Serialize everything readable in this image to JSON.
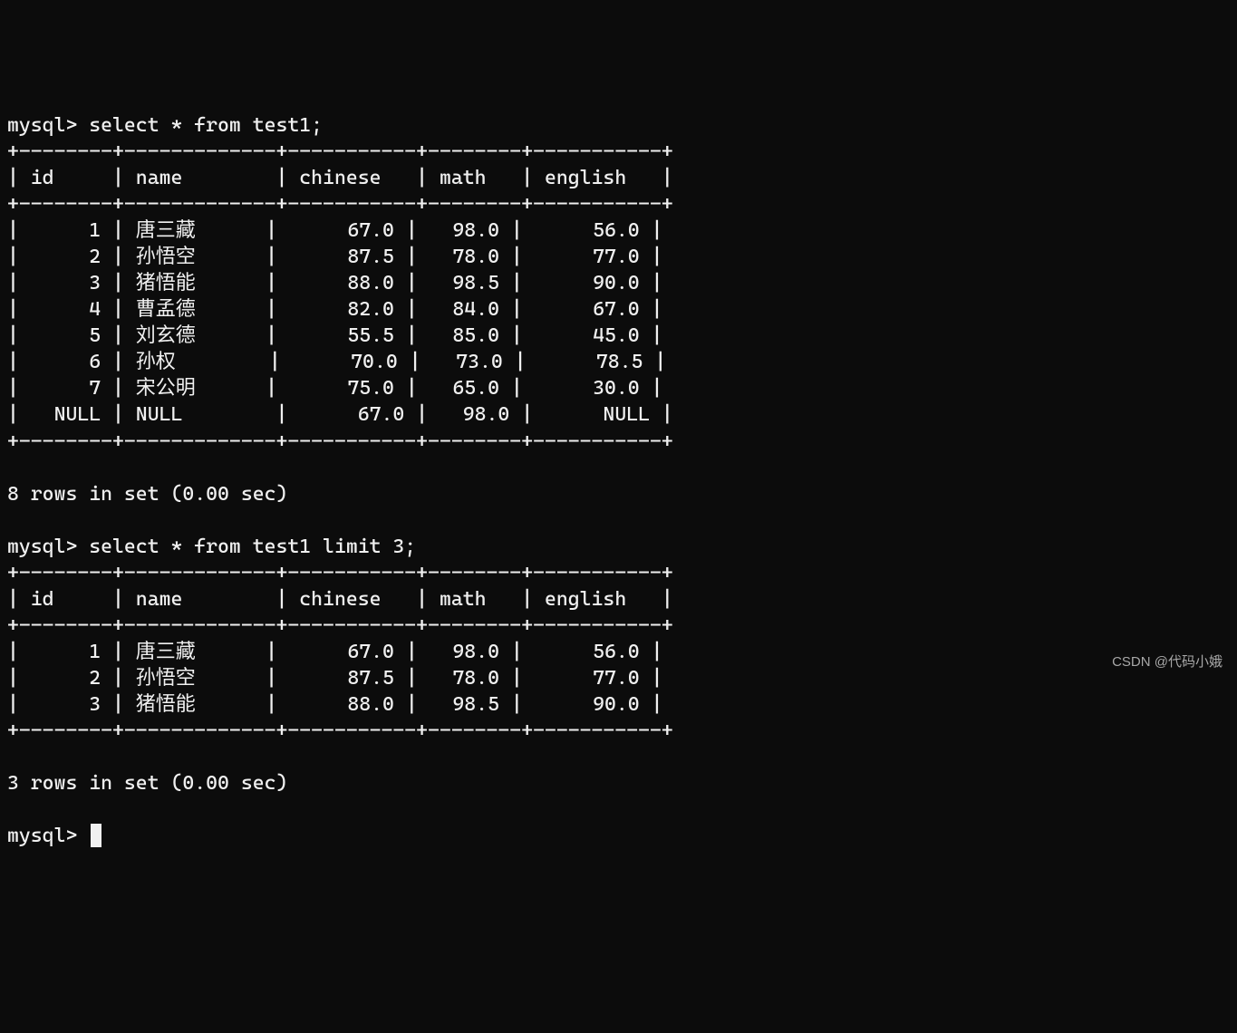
{
  "prompt": "mysql> ",
  "query1": {
    "sql": "select * from test1;",
    "columns": [
      "id",
      "name",
      "chinese",
      "math",
      "english"
    ],
    "widths": [
      6,
      11,
      9,
      6,
      9
    ],
    "rows": [
      {
        "id": "1",
        "name": "唐三藏",
        "chinese": "67.0",
        "math": "98.0",
        "english": "56.0"
      },
      {
        "id": "2",
        "name": "孙悟空",
        "chinese": "87.5",
        "math": "78.0",
        "english": "77.0"
      },
      {
        "id": "3",
        "name": "猪悟能",
        "chinese": "88.0",
        "math": "98.5",
        "english": "90.0"
      },
      {
        "id": "4",
        "name": "曹孟德",
        "chinese": "82.0",
        "math": "84.0",
        "english": "67.0"
      },
      {
        "id": "5",
        "name": "刘玄德",
        "chinese": "55.5",
        "math": "85.0",
        "english": "45.0"
      },
      {
        "id": "6",
        "name": "孙权",
        "chinese": "70.0",
        "math": "73.0",
        "english": "78.5"
      },
      {
        "id": "7",
        "name": "宋公明",
        "chinese": "75.0",
        "math": "65.0",
        "english": "30.0"
      },
      {
        "id": "NULL",
        "name": "NULL",
        "chinese": "67.0",
        "math": "98.0",
        "english": "NULL"
      }
    ],
    "footer": "8 rows in set (0.00 sec)"
  },
  "query2": {
    "sql": "select * from test1 limit 3;",
    "columns": [
      "id",
      "name",
      "chinese",
      "math",
      "english"
    ],
    "widths": [
      6,
      11,
      9,
      6,
      9
    ],
    "rows": [
      {
        "id": "1",
        "name": "唐三藏",
        "chinese": "67.0",
        "math": "98.0",
        "english": "56.0"
      },
      {
        "id": "2",
        "name": "孙悟空",
        "chinese": "87.5",
        "math": "78.0",
        "english": "77.0"
      },
      {
        "id": "3",
        "name": "猪悟能",
        "chinese": "88.0",
        "math": "98.5",
        "english": "90.0"
      }
    ],
    "footer": "3 rows in set (0.00 sec)"
  },
  "watermark": "CSDN @代码小娥"
}
